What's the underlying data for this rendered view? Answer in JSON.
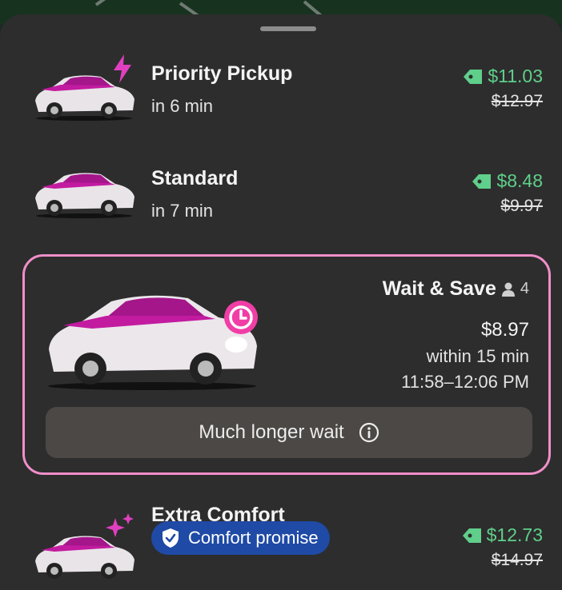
{
  "options": [
    {
      "title": "Priority Pickup",
      "eta": "in 6 min",
      "price": "$11.03",
      "original_price": "$12.97",
      "accent_icon": "lightning-icon"
    },
    {
      "title": "Standard",
      "eta": "in 7 min",
      "price": "$8.48",
      "original_price": "$9.97"
    },
    {
      "title": "Extra Comfort",
      "badge": "Comfort promise",
      "price": "$12.73",
      "original_price": "$14.97",
      "accent_icon": "sparkles-icon"
    }
  ],
  "wait_save": {
    "title": "Wait & Save",
    "seats": "4",
    "price": "$8.97",
    "within": "within 15 min",
    "window": "11:58–12:06 PM",
    "notice": "Much longer wait",
    "accent_icon": "clock-icon"
  },
  "colors": {
    "sheet": "#2d2d2d",
    "discount": "#5fcf8b",
    "highlight_border": "#f08fc9",
    "brand_pink": "#f03ea6",
    "badge": "#1f4aa6"
  }
}
